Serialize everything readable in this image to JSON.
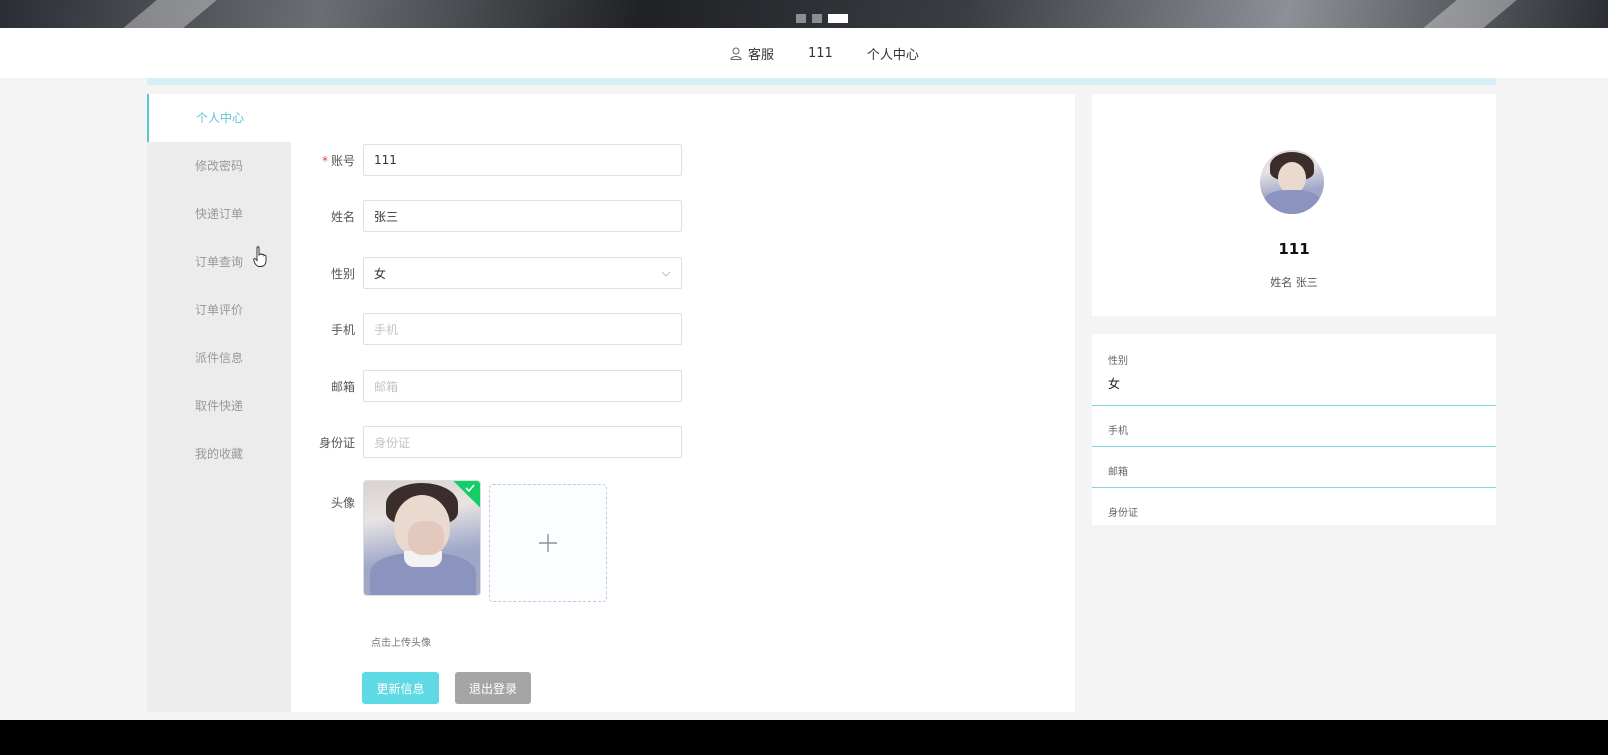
{
  "banner": {
    "slides": 3,
    "active_slide": 3
  },
  "topnav": {
    "service_label": "客服",
    "username": "111",
    "center_label": "个人中心"
  },
  "sidebar": {
    "items": [
      {
        "label": "个人中心",
        "active": true
      },
      {
        "label": "修改密码",
        "active": false
      },
      {
        "label": "快递订单",
        "active": false
      },
      {
        "label": "订单查询",
        "active": false
      },
      {
        "label": "订单评价",
        "active": false
      },
      {
        "label": "派件信息",
        "active": false
      },
      {
        "label": "取件快递",
        "active": false
      },
      {
        "label": "我的收藏",
        "active": false
      }
    ]
  },
  "form": {
    "account": {
      "label": "账号",
      "required_mark": "*",
      "value": "111"
    },
    "name": {
      "label": "姓名",
      "value": "张三"
    },
    "gender": {
      "label": "性别",
      "value": "女"
    },
    "phone": {
      "label": "手机",
      "placeholder": "手机"
    },
    "email": {
      "label": "邮箱",
      "placeholder": "邮箱"
    },
    "idcard": {
      "label": "身份证",
      "placeholder": "身份证"
    },
    "avatar": {
      "label": "头像",
      "tip": "点击上传头像"
    },
    "update_button": "更新信息",
    "logout_button": "退出登录"
  },
  "profile": {
    "username": "111",
    "realname": "姓名 张三"
  },
  "info": {
    "gender_key": "性别",
    "gender_val": "女",
    "phone_key": "手机",
    "email_key": "邮箱",
    "idcard_key": "身份证"
  },
  "colors": {
    "accent": "#5dc6d3",
    "primary_button": "#5fd9e3",
    "gray_button": "#a5a5a5",
    "success": "#13ce66"
  }
}
